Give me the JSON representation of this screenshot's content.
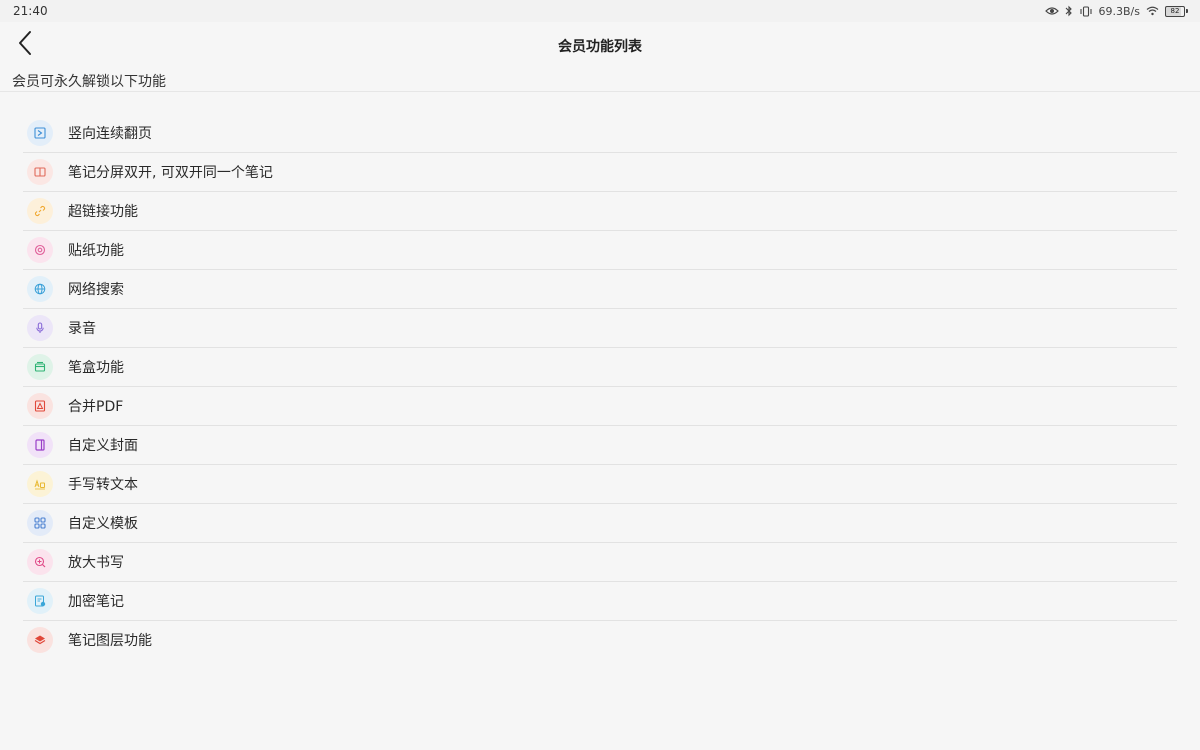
{
  "status": {
    "time": "21:40",
    "net_speed": "69.3B/s",
    "battery": "82"
  },
  "header": {
    "title": "会员功能列表",
    "subtitle": "会员可永久解锁以下功能"
  },
  "features": [
    {
      "label": "竖向连续翻页",
      "icon": "vertical-scroll-icon",
      "color": "#3d8fd6",
      "bg": "#e3eef9"
    },
    {
      "label": "笔记分屏双开, 可双开同一个笔记",
      "icon": "split-screen-icon",
      "color": "#e06a5a",
      "bg": "#fbe7e4"
    },
    {
      "label": "超链接功能",
      "icon": "link-icon",
      "color": "#f0a830",
      "bg": "#fdf0da"
    },
    {
      "label": "贴纸功能",
      "icon": "sticker-icon",
      "color": "#e0609a",
      "bg": "#fbe4ee"
    },
    {
      "label": "网络搜索",
      "icon": "globe-icon",
      "color": "#3aa0d8",
      "bg": "#e2f0f9"
    },
    {
      "label": "录音",
      "icon": "microphone-icon",
      "color": "#8a6cd8",
      "bg": "#ece6f8"
    },
    {
      "label": "笔盒功能",
      "icon": "pen-box-icon",
      "color": "#2fb374",
      "bg": "#dff3e8"
    },
    {
      "label": "合并PDF",
      "icon": "pdf-icon",
      "color": "#e0483a",
      "bg": "#fae3e0"
    },
    {
      "label": "自定义封面",
      "icon": "cover-icon",
      "color": "#9a3fc8",
      "bg": "#f1e2f8"
    },
    {
      "label": "手写转文本",
      "icon": "handwriting-text-icon",
      "color": "#e8b830",
      "bg": "#fcf3d6"
    },
    {
      "label": "自定义模板",
      "icon": "template-grid-icon",
      "color": "#4a7fd0",
      "bg": "#e3ebf8"
    },
    {
      "label": "放大书写",
      "icon": "zoom-in-icon",
      "color": "#e04a88",
      "bg": "#fbe3ed"
    },
    {
      "label": "加密笔记",
      "icon": "encrypted-note-icon",
      "color": "#3aa6d8",
      "bg": "#e1f1f9"
    },
    {
      "label": "笔记图层功能",
      "icon": "layers-icon",
      "color": "#e0483a",
      "bg": "#fae2df"
    }
  ]
}
